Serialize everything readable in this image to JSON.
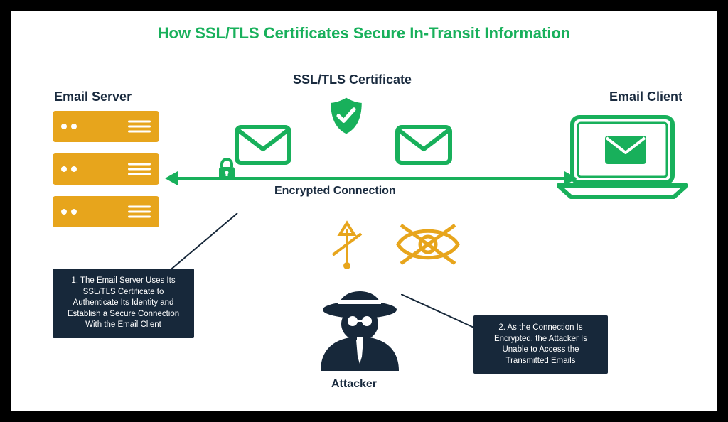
{
  "title": "How SSL/TLS Certificates Secure In-Transit Information",
  "labels": {
    "server": "Email Server",
    "cert": "SSL/TLS Certificate",
    "client": "Email Client",
    "connection": "Encrypted  Connection",
    "attacker": "Attacker"
  },
  "notes": {
    "n1": "1. The Email Server Uses Its SSL/TLS Certificate to Authenticate Its Identity and Establish a Secure Connection With the Email Client",
    "n2": "2. As the Connection Is Encrypted, the Attacker Is Unable to Access the Transmitted Emails"
  },
  "colors": {
    "green": "#18b05b",
    "amber": "#e7a51c",
    "navy": "#17283a"
  }
}
